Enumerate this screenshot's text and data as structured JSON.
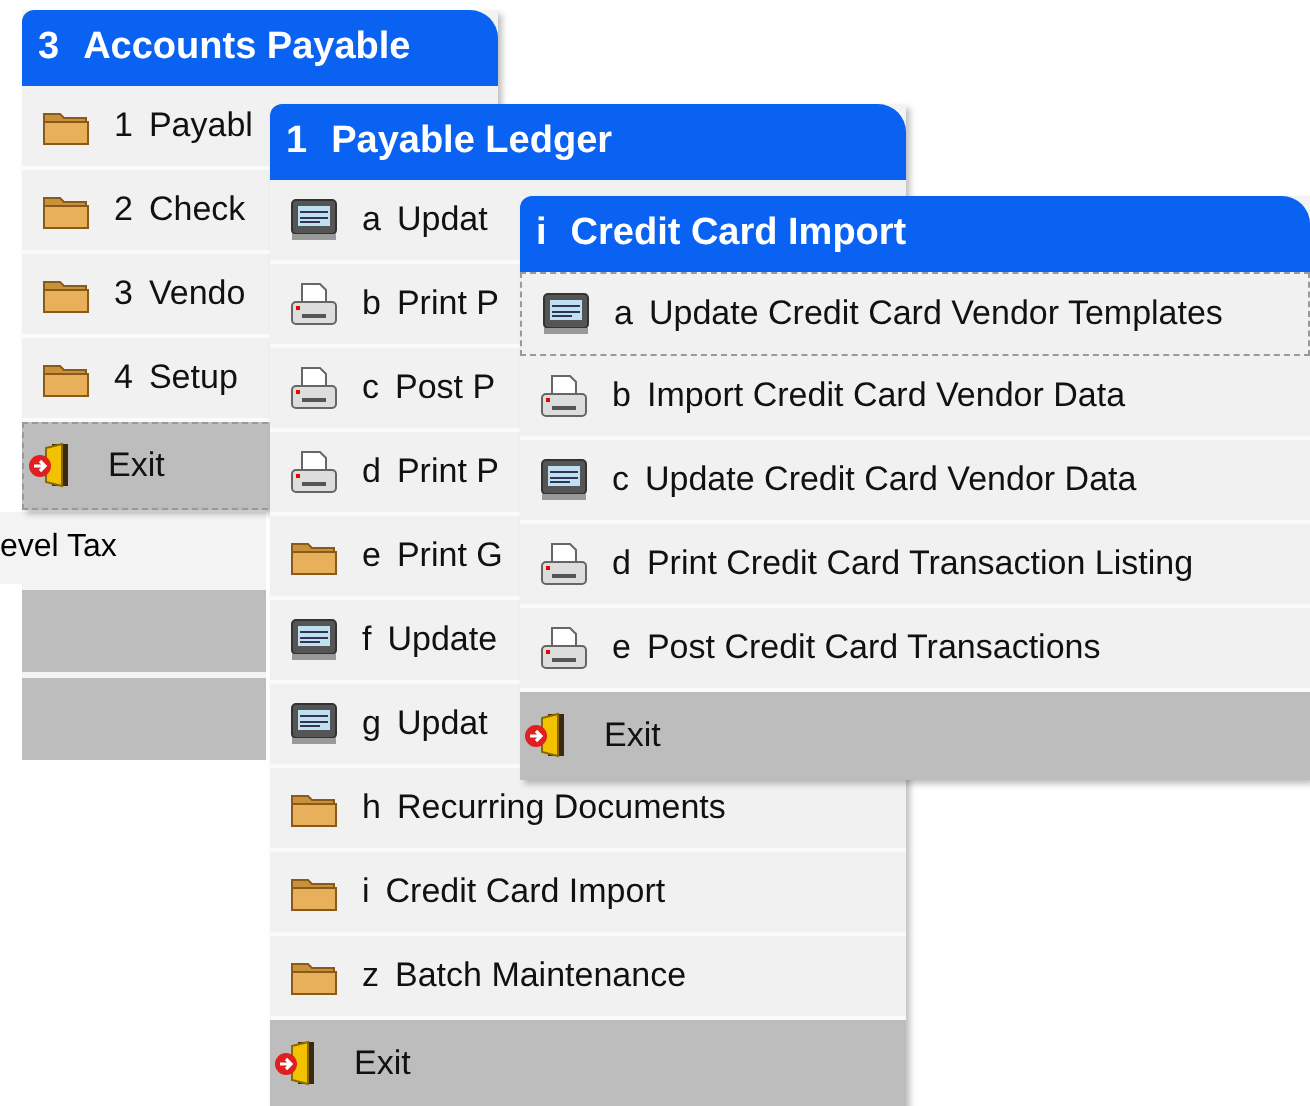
{
  "back_panel": {
    "rows": [
      {
        "label": "evel Tax",
        "shaded": false
      },
      {
        "shaded": true
      },
      {
        "shaded": true
      }
    ]
  },
  "menus": [
    {
      "key": "3",
      "title": "Accounts Payable",
      "items": [
        {
          "kind": "folder",
          "key": "1",
          "label": "Payabl",
          "focused": false
        },
        {
          "kind": "folder",
          "key": "2",
          "label": "Check",
          "focused": false
        },
        {
          "kind": "folder",
          "key": "3",
          "label": "Vendo",
          "focused": false
        },
        {
          "kind": "folder",
          "key": "4",
          "label": "Setup",
          "focused": false
        },
        {
          "kind": "exit",
          "label": "Exit",
          "focused": true
        }
      ]
    },
    {
      "key": "1",
      "title": "Payable Ledger",
      "items": [
        {
          "kind": "screen",
          "key": "a",
          "label": "Updat",
          "focused": false
        },
        {
          "kind": "printer",
          "key": "b",
          "label": "Print P",
          "focused": false
        },
        {
          "kind": "printer",
          "key": "c",
          "label": "Post P",
          "focused": false
        },
        {
          "kind": "printer",
          "key": "d",
          "label": "Print P",
          "focused": false
        },
        {
          "kind": "folder",
          "key": "e",
          "label": "Print G",
          "focused": false
        },
        {
          "kind": "screen",
          "key": "f",
          "label": "Update",
          "focused": false
        },
        {
          "kind": "screen",
          "key": "g",
          "label": "Updat",
          "focused": false
        },
        {
          "kind": "folder",
          "key": "h",
          "label": "Recurring Documents",
          "focused": false
        },
        {
          "kind": "folder",
          "key": "i",
          "label": "Credit Card Import",
          "focused": false
        },
        {
          "kind": "folder",
          "key": "z",
          "label": "Batch Maintenance",
          "focused": false
        },
        {
          "kind": "exit",
          "label": "Exit",
          "focused": false
        }
      ]
    },
    {
      "key": "i",
      "title": "Credit Card Import",
      "items": [
        {
          "kind": "screen",
          "key": "a",
          "label": "Update Credit Card Vendor Templates",
          "focused": true
        },
        {
          "kind": "printer",
          "key": "b",
          "label": "Import Credit Card Vendor Data",
          "focused": false
        },
        {
          "kind": "screen",
          "key": "c",
          "label": "Update Credit Card Vendor Data",
          "focused": false
        },
        {
          "kind": "printer",
          "key": "d",
          "label": "Print Credit Card Transaction Listing",
          "focused": false
        },
        {
          "kind": "printer",
          "key": "e",
          "label": "Post Credit Card Transactions",
          "focused": false
        },
        {
          "kind": "exit",
          "label": "Exit",
          "focused": false
        }
      ]
    }
  ]
}
